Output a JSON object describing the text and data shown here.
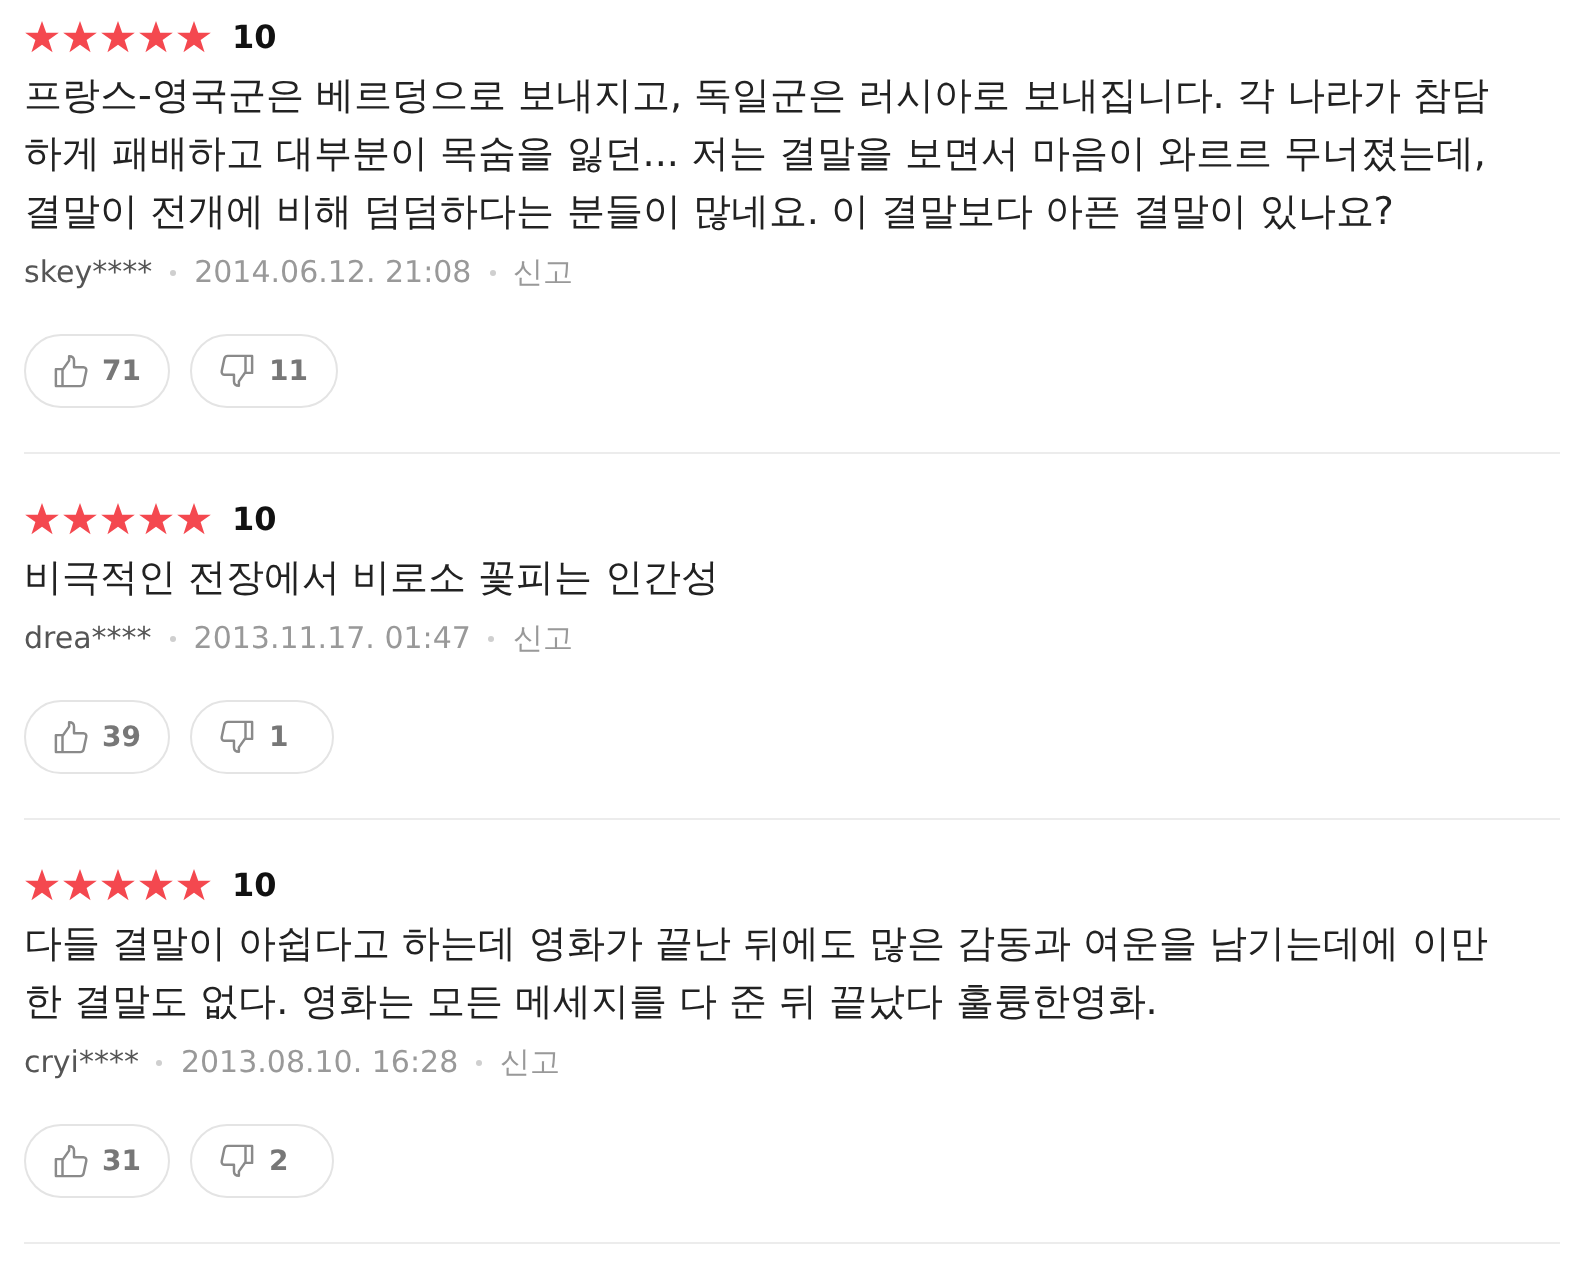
{
  "reviews": [
    {
      "stars": 5,
      "score": "10",
      "text": "프랑스-영국군은 베르덩으로 보내지고, 독일군은 러시아로 보내집니다. 각 나라가 참담하게 패배하고 대부분이 목숨을 잃던... 저는 결말을 보면서 마음이 와르르 무너졌는데, 결말이 전개에 비해 덤덤하다는 분들이 많네요. 이 결말보다 아픈 결말이 있나요?",
      "author": "skey****",
      "date": "2014.06.12. 21:08",
      "report": "신고",
      "likes": "71",
      "dislikes": "11"
    },
    {
      "stars": 5,
      "score": "10",
      "text": "비극적인 전장에서 비로소 꽃피는 인간성",
      "author": "drea****",
      "date": "2013.11.17. 01:47",
      "report": "신고",
      "likes": "39",
      "dislikes": "1"
    },
    {
      "stars": 5,
      "score": "10",
      "text": "다들 결말이 아쉽다고 하는데 영화가 끝난 뒤에도 많은 감동과 여운을 남기는데에 이만한 결말도 없다. 영화는 모든 메세지를 다 준 뒤 끝났다 훌륭한영화.",
      "author": "cryi****",
      "date": "2013.08.10. 16:28",
      "report": "신고",
      "likes": "31",
      "dislikes": "2"
    }
  ]
}
